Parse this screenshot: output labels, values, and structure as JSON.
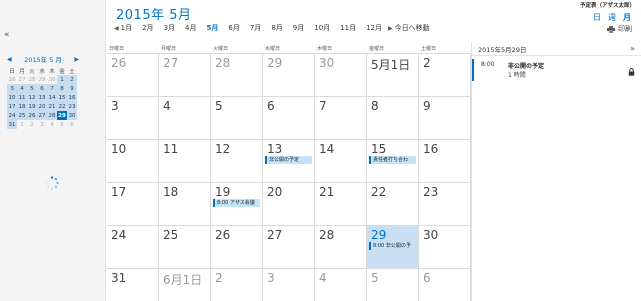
{
  "header": {
    "title": "2015年 5月",
    "calendar_name": "予定表（アザス太郎）",
    "views": [
      "日",
      "週",
      "月"
    ],
    "active_view": "月",
    "print_label": "印刷",
    "months": [
      "1月",
      "2月",
      "3月",
      "4月",
      "5月",
      "6月",
      "7月",
      "8月",
      "9月",
      "10月",
      "11月",
      "12月"
    ],
    "active_month": "5月",
    "goto_today": "今日へ移動"
  },
  "sidebar": {
    "collapse_icon": "«",
    "mini_title": "2015年 5 月",
    "dow": [
      "日",
      "月",
      "火",
      "水",
      "木",
      "金",
      "土"
    ],
    "rows": [
      [
        "26",
        "27",
        "28",
        "29",
        "30",
        "1",
        "2"
      ],
      [
        "3",
        "4",
        "5",
        "6",
        "7",
        "8",
        "9"
      ],
      [
        "10",
        "11",
        "12",
        "13",
        "14",
        "15",
        "16"
      ],
      [
        "17",
        "18",
        "19",
        "20",
        "21",
        "22",
        "23"
      ],
      [
        "24",
        "25",
        "26",
        "27",
        "28",
        "29",
        "30"
      ],
      [
        "31",
        "1",
        "2",
        "3",
        "4",
        "5",
        "6"
      ]
    ],
    "today": "29"
  },
  "month": {
    "dow": [
      "日曜日",
      "月曜日",
      "火曜日",
      "水曜日",
      "木曜日",
      "金曜日",
      "土曜日"
    ],
    "weeks": [
      [
        {
          "d": "26",
          "o": true
        },
        {
          "d": "27",
          "o": true
        },
        {
          "d": "28",
          "o": true
        },
        {
          "d": "29",
          "o": true
        },
        {
          "d": "30",
          "o": true
        },
        {
          "d": "5月1日"
        },
        {
          "d": "2"
        }
      ],
      [
        {
          "d": "3"
        },
        {
          "d": "4"
        },
        {
          "d": "5"
        },
        {
          "d": "6"
        },
        {
          "d": "7"
        },
        {
          "d": "8"
        },
        {
          "d": "9"
        }
      ],
      [
        {
          "d": "10"
        },
        {
          "d": "11"
        },
        {
          "d": "12"
        },
        {
          "d": "13",
          "e": "非公開の予定"
        },
        {
          "d": "14"
        },
        {
          "d": "15",
          "e": "責任者打ち合わ"
        },
        {
          "d": "16"
        }
      ],
      [
        {
          "d": "17"
        },
        {
          "d": "18"
        },
        {
          "d": "19",
          "e": "8:00 アザス会議"
        },
        {
          "d": "20"
        },
        {
          "d": "21"
        },
        {
          "d": "22"
        },
        {
          "d": "23"
        }
      ],
      [
        {
          "d": "24"
        },
        {
          "d": "25"
        },
        {
          "d": "26"
        },
        {
          "d": "27"
        },
        {
          "d": "28"
        },
        {
          "d": "29",
          "e": "8:00 非公開の予",
          "sel": true
        },
        {
          "d": "30"
        }
      ],
      [
        {
          "d": "31"
        },
        {
          "d": "6月1日",
          "o": true
        },
        {
          "d": "2",
          "o": true
        },
        {
          "d": "3",
          "o": true
        },
        {
          "d": "4",
          "o": true
        },
        {
          "d": "5",
          "o": true
        },
        {
          "d": "6",
          "o": true
        }
      ]
    ]
  },
  "agenda": {
    "date_title": "2015年5月29日",
    "expand_icon": "»",
    "item": {
      "time": "8:00",
      "subject": "非公開の予定",
      "duration": "1 時間"
    }
  },
  "colors": {
    "accent": "#0072c6",
    "event_bg": "#c5e3f6",
    "selected_day": "#c9dff3"
  }
}
